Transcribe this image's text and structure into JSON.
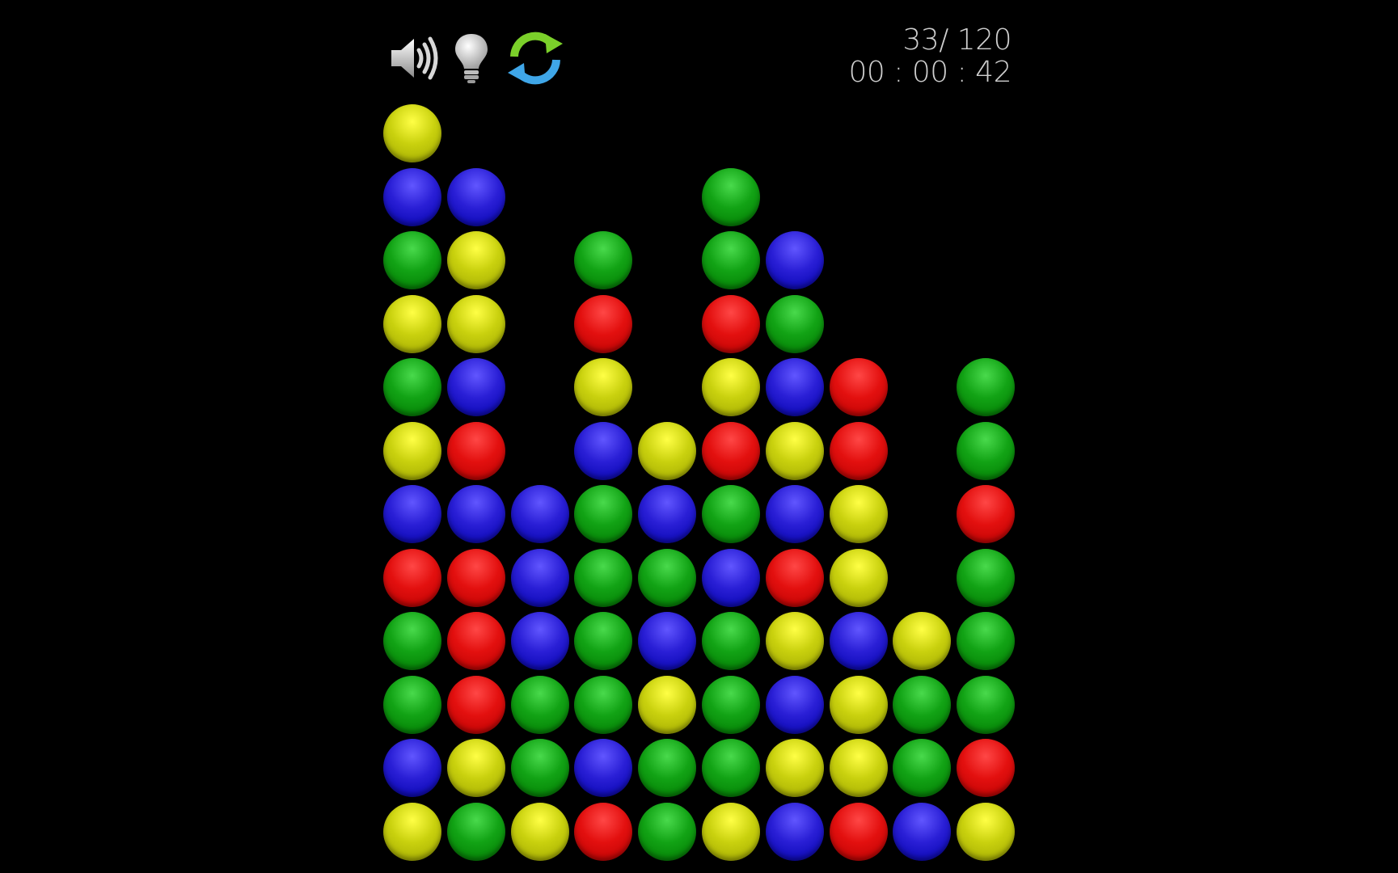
{
  "toolbar": {
    "sound_icon": "speaker-icon",
    "hint_icon": "lightbulb-icon",
    "restart_icon": "refresh-arrows-icon"
  },
  "hud": {
    "progress": "33/ 120",
    "timer": "00 : 00 : 42"
  },
  "colors": {
    "Y": "#c9d10e",
    "B": "#2a1fd6",
    "G": "#12a315",
    "R": "#e3100f"
  },
  "board": {
    "columns": 10,
    "rows": 12,
    "grid": [
      "Y.........",
      "BB...G....",
      "GY.G.GB...",
      "YY.R.RG...",
      "GB.Y.YBR.G",
      "YR.BYRYR.G",
      "BBBGBGBY.R",
      "RRBGGBRY.G",
      "GRBGBGYBYG",
      "GRGGYGBYGG",
      "BYGBGGYYGR",
      "YGYRGYBRBY"
    ]
  }
}
